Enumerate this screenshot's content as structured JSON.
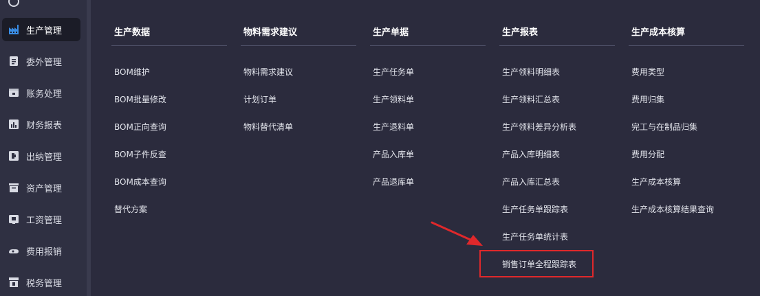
{
  "sidebar": {
    "items": [
      {
        "label": "",
        "icon": "partial-icon"
      },
      {
        "label": "生产管理",
        "icon": "factory-icon",
        "active": true
      },
      {
        "label": "委外管理",
        "icon": "clipboard-icon"
      },
      {
        "label": "账务处理",
        "icon": "ledger-icon"
      },
      {
        "label": "财务报表",
        "icon": "report-chart-icon"
      },
      {
        "label": "出纳管理",
        "icon": "cashier-icon"
      },
      {
        "label": "资产管理",
        "icon": "asset-box-icon"
      },
      {
        "label": "工资管理",
        "icon": "payroll-icon"
      },
      {
        "label": "费用报销",
        "icon": "expense-icon"
      },
      {
        "label": "税务管理",
        "icon": "tax-icon"
      }
    ]
  },
  "menu": {
    "columns": [
      {
        "title": "生产数据",
        "items": [
          "BOM维护",
          "BOM批量修改",
          "BOM正向查询",
          "BOM子件反查",
          "BOM成本查询",
          "替代方案"
        ]
      },
      {
        "title": "物料需求建议",
        "items": [
          "物料需求建议",
          "计划订单",
          "物料替代清单"
        ]
      },
      {
        "title": "生产单据",
        "items": [
          "生产任务单",
          "生产领料单",
          "生产退料单",
          "产品入库单",
          "产品退库单"
        ]
      },
      {
        "title": "生产报表",
        "items": [
          "生产领料明细表",
          "生产领料汇总表",
          "生产领料差异分析表",
          "产品入库明细表",
          "产品入库汇总表",
          "生产任务单跟踪表",
          "生产任务单统计表",
          "销售订单全程跟踪表"
        ]
      },
      {
        "title": "生产成本核算",
        "items": [
          "费用类型",
          "费用归集",
          "完工与在制品归集",
          "费用分配",
          "生产成本核算",
          "生产成本核算结果查询"
        ]
      }
    ]
  },
  "annotation": {
    "box_color": "#e0282b",
    "arrow_color": "#e0282b"
  }
}
